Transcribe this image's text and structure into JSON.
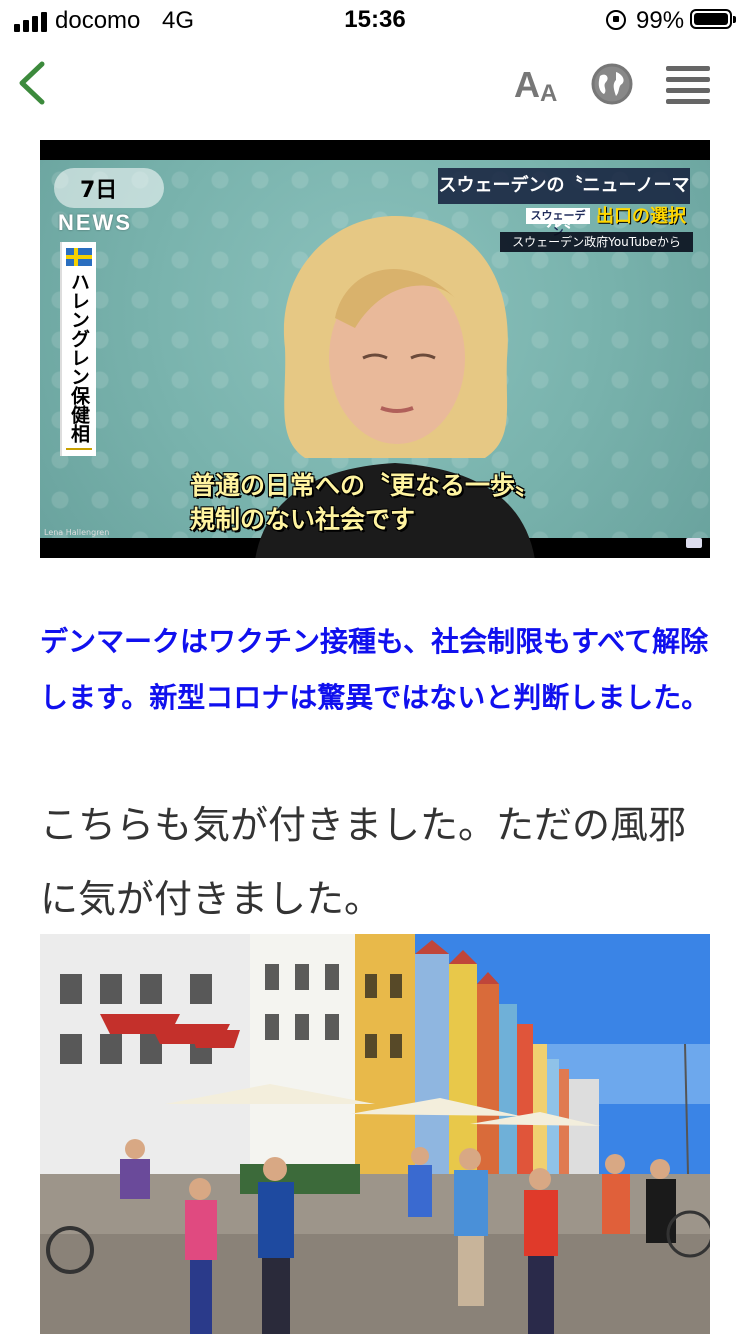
{
  "status_bar": {
    "carrier": "docomo",
    "network": "4G",
    "time": "15:36",
    "battery_percent_label": "99%",
    "battery_level": 0.99
  },
  "toolbar": {
    "text_size_big": "A",
    "text_size_small": "A"
  },
  "video": {
    "date_label": "7日",
    "news_label": "NEWS",
    "speaker_name": "ハレングレン保健相",
    "headline": "スウェーデンの〝ニューノーマル〟",
    "tag": "スウェーデン",
    "subtitle_topic": "出口の選択",
    "source": "スウェーデン政府YouTubeから",
    "caption_line1": "普通の日常への〝更なる一歩〟",
    "caption_line2": "規制のない社会です",
    "credit": "Lena Hallengren"
  },
  "article": {
    "headline": "デンマークはワクチン接種も、社会制限もすべて解除します。新型コロナは驚異ではないと判断しました。",
    "body": "こちらも気が付きました。ただの風邪に気が付きました。"
  },
  "colors": {
    "headline_blue": "#1010ee",
    "back_green": "#3c8a3c",
    "icon_gray": "#777777"
  }
}
